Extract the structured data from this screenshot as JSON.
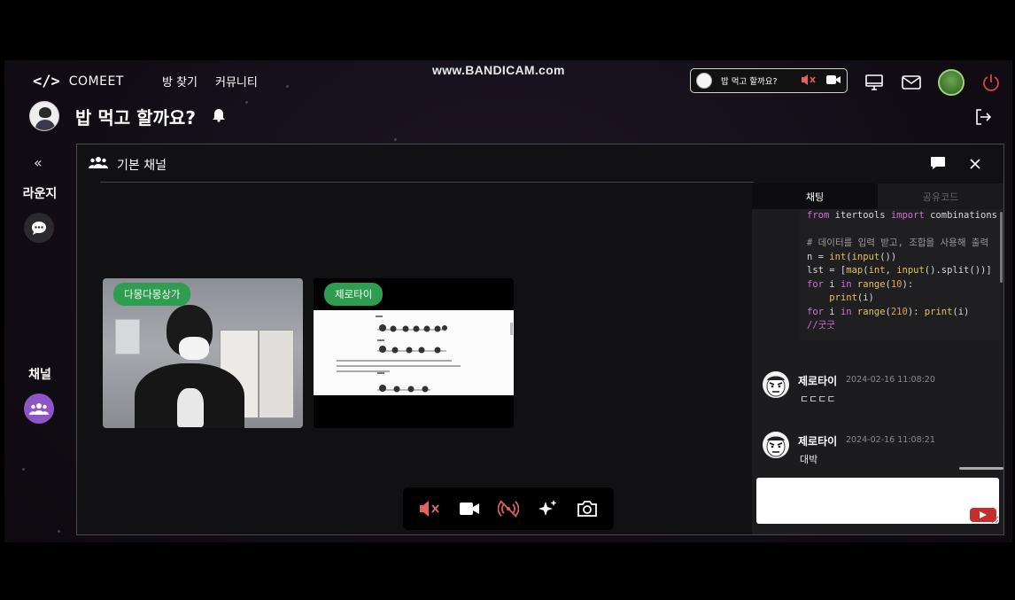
{
  "watermark": "www.BANDICAM.com",
  "brand": {
    "logo": "</>",
    "name": "COMEET"
  },
  "nav": [
    {
      "label": "방 찾기"
    },
    {
      "label": "커뮤니티"
    }
  ],
  "mini_call": {
    "title": "밥 먹고 할까요?"
  },
  "room": {
    "title": "밥 먹고 할까요?"
  },
  "sidebar": {
    "collapse": "«",
    "lounge_label": "라운지",
    "channel_label": "채널"
  },
  "panel": {
    "channel_name": "기본 채널"
  },
  "tiles": [
    {
      "name": "다몽다몽상가"
    },
    {
      "name": "제로타이"
    }
  ],
  "chat": {
    "tabs": [
      {
        "label": "채팅",
        "active": true
      },
      {
        "label": "공유코드",
        "active": false
      }
    ],
    "code_lines": [
      "from itertools import combinations as",
      "",
      "# 데이터를 입력 받고, 조합을 사용해 출력",
      "n = int(input())",
      "lst = [map(int, input().split())]",
      "for i in range(10):",
      "    print(i)",
      "for i in range(210): print(i)",
      "//굿굿"
    ],
    "messages": [
      {
        "author": "제로타이",
        "time": "2024-02-16 11:08:20",
        "text": "ㄷㄷㄷㄷ"
      },
      {
        "author": "제로타이",
        "time": "2024-02-16 11:08:21",
        "text": "대박"
      }
    ],
    "input_value": ""
  },
  "colors": {
    "accent_green": "#2e9d50",
    "accent_purple": "#8e55c9",
    "danger": "#c62e2e"
  }
}
